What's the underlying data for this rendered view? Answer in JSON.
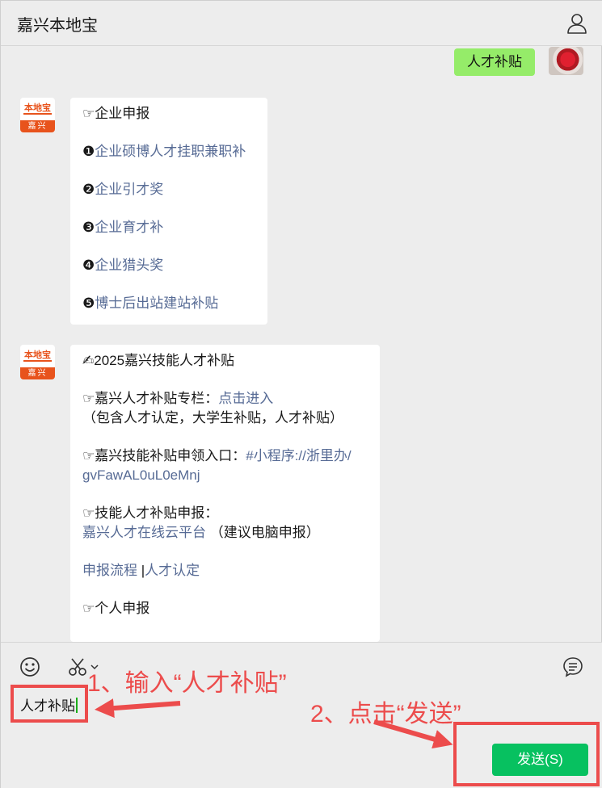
{
  "window": {
    "title": "嘉兴本地宝"
  },
  "chat": {
    "self_message": "人才补贴",
    "bot_avatar": {
      "logo_text": "本地宝",
      "city": "嘉兴"
    },
    "message_1": {
      "heading": "☞企业申报",
      "items": [
        {
          "num": "❶",
          "text": "企业硕博人才挂职兼职补"
        },
        {
          "num": "❷",
          "text": "企业引才奖"
        },
        {
          "num": "❸",
          "text": "企业育才补"
        },
        {
          "num": "❹",
          "text": "企业猎头奖"
        },
        {
          "num": "❺",
          "text": "博士后出站建站补贴"
        }
      ]
    },
    "message_2": {
      "title": "✍2025嘉兴技能人才补贴",
      "column_label": "☞嘉兴人才补贴专栏：",
      "column_link": "点击进入",
      "column_note": "（包含人才认定，大学生补贴，人才补贴）",
      "entry_label": "☞嘉兴技能补贴申领入口：",
      "entry_link_1": "#小程序://浙里办/",
      "entry_link_2": "gvFawAL0uL0eMnj",
      "apply_label": "☞技能人才补贴申报：",
      "apply_link": "嘉兴人才在线云平台",
      "apply_note": "（建议电脑申报）",
      "process_link": "申报流程",
      "separator": "|",
      "cert_link": "人才认定",
      "personal_label": "☞个人申报"
    }
  },
  "composer": {
    "input_value": "人才补贴",
    "send_label": "发送(S)"
  },
  "annotations": {
    "step1": "1、输入“人才补贴”",
    "step2": "2、点击“发送”",
    "color": "#ec4c4c"
  },
  "icons": {
    "profile": "person-icon",
    "emoji": "smiley-icon",
    "scissors": "scissors-icon",
    "history": "chat-history-icon"
  }
}
